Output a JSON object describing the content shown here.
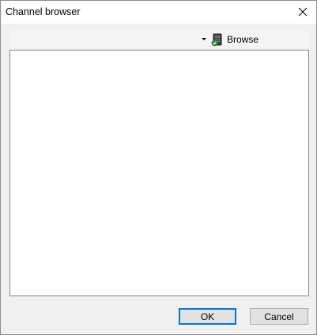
{
  "window": {
    "title": "Channel browser",
    "close_icon": "close-icon"
  },
  "toolbar": {
    "dropdown_icon": "dropdown-arrow-icon",
    "browse_icon": "browse-device-icon",
    "browse_label": "Browse"
  },
  "buttons": {
    "ok_label": "OK",
    "cancel_label": "Cancel"
  },
  "colors": {
    "focus_border": "#0078d7",
    "button_face": "#e1e1e1",
    "dialog_background": "#f0f0f0"
  }
}
